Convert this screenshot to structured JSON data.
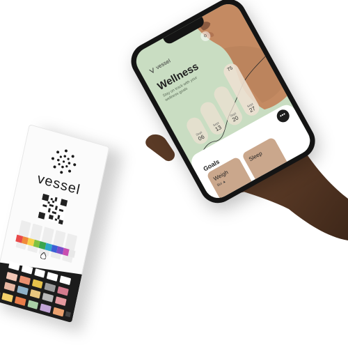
{
  "strip": {
    "brand": "vessel",
    "pad_colors": [
      "#e94a4a",
      "#f08a3a",
      "#f5d24a",
      "#7fc241",
      "#3aa64e",
      "#2fa6c9",
      "#3b5fd6",
      "#7b4fc9",
      "#c94fb0",
      "#e8e8e8"
    ],
    "grid_colors": [
      "#ffffff",
      "#ffffff",
      "#ffffff",
      "#ffffff",
      "#ffffff",
      "#f2c6b5",
      "#e98f6f",
      "#e6c24a",
      "#9c9c9c",
      "#d47b8e",
      "#e7b7a3",
      "#8fb1c9",
      "#e9c77f",
      "#b9b9b9",
      "#e59aa0",
      "#f2d06a",
      "#e97d4a",
      "#a9d1a6",
      "#c2a4d6",
      "#eaa16f"
    ],
    "brand_color": "#1a1a1a"
  },
  "phone": {
    "logo": "vessel",
    "title": "Wellness",
    "subtitle": "Stay on track with your wellness goals",
    "pills": [
      {
        "month": "Sept",
        "day": "06"
      },
      {
        "month": "Sept",
        "day": "13"
      },
      {
        "month": "Sept",
        "day": "20"
      },
      {
        "month": "Sept",
        "day": "27"
      }
    ],
    "highlight_value": "75",
    "goals_label": "Goals",
    "goal_cards": [
      {
        "title": "Weigh",
        "subtitle": "Bui ▲"
      },
      {
        "title": "Sleep",
        "subtitle": ""
      }
    ],
    "more_label": "•••",
    "cam_label": "⊙",
    "screen_color": "#c9ddc2",
    "skin_color": "#c48a62"
  },
  "hand": {
    "skin_color": "#5a3a26",
    "highlight_color": "#7a5038"
  }
}
